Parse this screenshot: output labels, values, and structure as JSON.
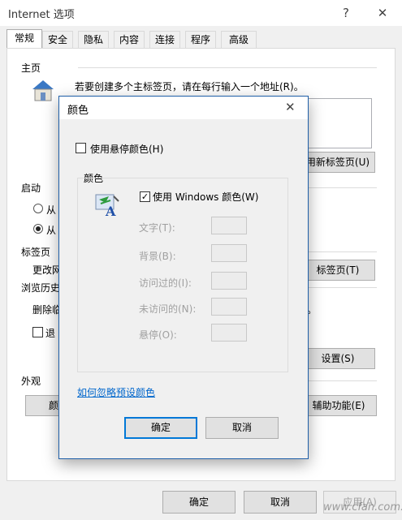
{
  "window": {
    "title": "Internet 选项",
    "help_glyph": "?",
    "close_glyph": "✕"
  },
  "tabs": [
    "常规",
    "安全",
    "隐私",
    "内容",
    "连接",
    "程序",
    "高级"
  ],
  "general": {
    "home_section": "主页",
    "home_instruction": "若要创建多个主标签页，请在每行输入一个地址(R)。",
    "new_tab_button": "用新标签页(U)",
    "startup_section": "启动",
    "startup_option1": "从",
    "startup_option2": "从",
    "tabs_section": "标签页",
    "tabs_change": "更改网",
    "tabs_button": "标签页(T)",
    "history_section": "浏览历史",
    "history_delete": "删除临",
    "history_tail": "。",
    "history_checkbox": "退",
    "settings_button": "设置(S)",
    "appearance_section": "外观",
    "colors_button": "颜",
    "accessibility_button": "辅助功能(E)"
  },
  "footer": {
    "ok": "确定",
    "cancel": "取消",
    "apply": "应用(A)"
  },
  "dialog": {
    "title": "颜色",
    "close_glyph": "✕",
    "hover_color_checkbox": "使用悬停颜色(H)",
    "hover_color_checked": false,
    "group_label": "颜色",
    "use_windows_colors": "使用 Windows 颜色(W)",
    "use_windows_checked": true,
    "rows": [
      {
        "label": "文字(T):"
      },
      {
        "label": "背景(B):"
      },
      {
        "label": "访问过的(I):"
      },
      {
        "label": "未访问的(N):"
      },
      {
        "label": "悬停(O):"
      }
    ],
    "link": "如何忽略预设颜色",
    "ok": "确定",
    "cancel": "取消"
  },
  "watermark": "www.cfan.com.cn"
}
